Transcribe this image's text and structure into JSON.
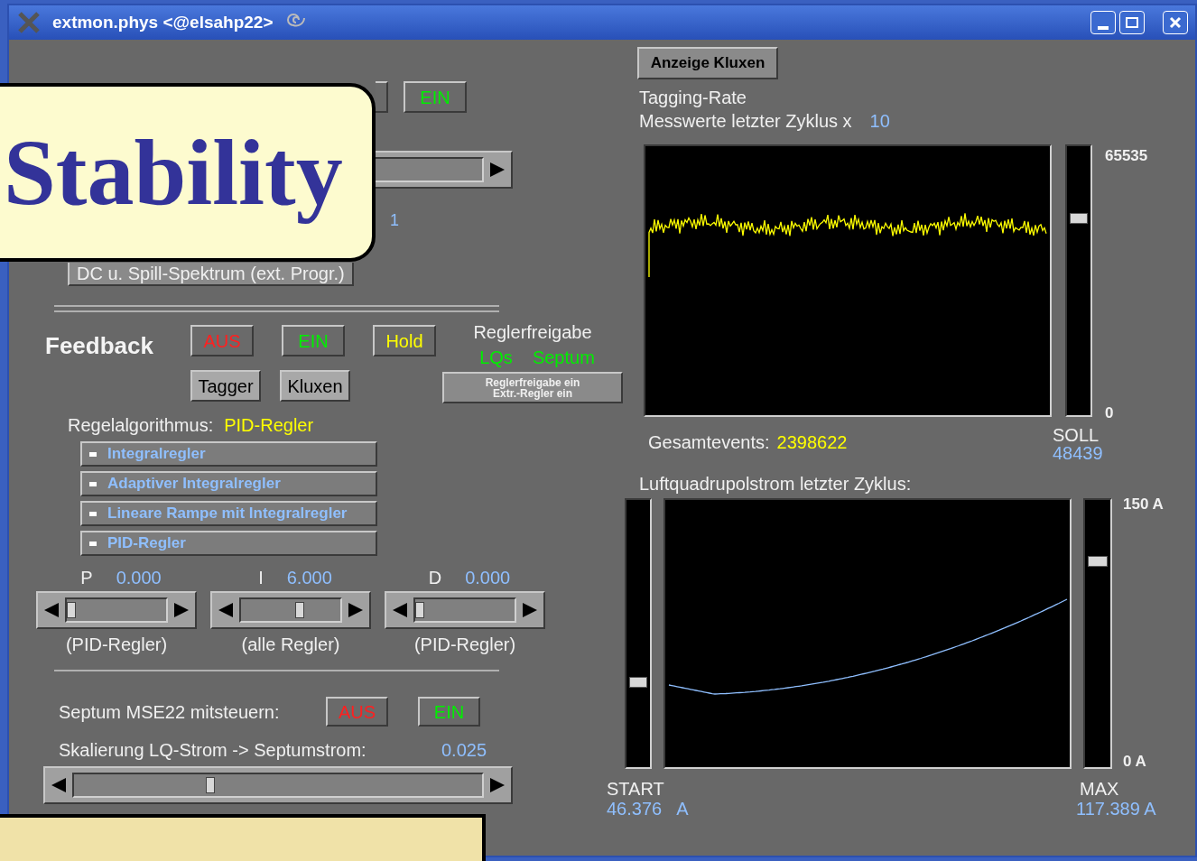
{
  "window": {
    "title": "extmon.phys <@elsahp22>"
  },
  "callout": {
    "text": "Stability"
  },
  "top_controls": {
    "buttons": [
      {
        "label": "EIN",
        "color": "#00ee00"
      }
    ],
    "value": "1",
    "spectrum_button": "DC u. Spill-Spektrum (ext. Progr.)"
  },
  "feedback": {
    "label": "Feedback",
    "buttons": [
      {
        "label": "AUS",
        "color": "#ff2020",
        "kind": "dark"
      },
      {
        "label": "EIN",
        "color": "#00ee00",
        "kind": "dark"
      },
      {
        "label": "Hold",
        "color": "#ffff00",
        "kind": "dark"
      },
      {
        "label": "Tagger",
        "color": "#000000",
        "kind": "light"
      },
      {
        "label": "Kluxen",
        "color": "#000000",
        "kind": "light"
      }
    ],
    "release": {
      "title": "Reglerfreigabe",
      "items": [
        "LQs",
        "Septum"
      ],
      "button_lines": [
        "Reglerfreigabe ein",
        "Extr.-Regler ein"
      ]
    }
  },
  "algorithm": {
    "label": "Regelalgorithmus:",
    "value": "PID-Regler",
    "options": [
      "Integralregler",
      "Adaptiver Integralregler",
      "Lineare Rampe mit Integralregler",
      "PID-Regler"
    ]
  },
  "pid": [
    {
      "name": "P",
      "value": "0.000",
      "level": 0,
      "caption": "(PID-Regler)"
    },
    {
      "name": "I",
      "value": "6.000",
      "level": 0.6,
      "caption": "(alle Regler)"
    },
    {
      "name": "D",
      "value": "0.000",
      "level": 0,
      "caption": "(PID-Regler)"
    }
  ],
  "septum": {
    "label": "Septum MSE22 mitsteuern:",
    "buttons": [
      {
        "label": "AUS",
        "color": "#ff2020"
      },
      {
        "label": "EIN",
        "color": "#00ee00"
      }
    ],
    "scale_label": "Skalierung LQ-Strom -> Septumstrom:",
    "scale_value": "0.025",
    "level": 0.33
  },
  "tagging": {
    "button": "Anzeige Kluxen",
    "title": "Tagging-Rate",
    "subtitle": "Messwerte letzter Zyklus x",
    "factor": "10",
    "max": "65535",
    "min": "0",
    "total_label": "Gesamtevents:",
    "total": "2398622",
    "setpoint": {
      "label": "SOLL",
      "value": "48439",
      "level": 0.74
    }
  },
  "current": {
    "title": "Luftquadrupolstrom letzter Zyklus:",
    "max": "150 A",
    "min": "0 A",
    "start": {
      "label": "START",
      "value": "46.376",
      "unit": "A",
      "level": 0.31
    },
    "maximum": {
      "label": "MAX",
      "value": "117.389 A",
      "level": 0.78
    }
  }
}
